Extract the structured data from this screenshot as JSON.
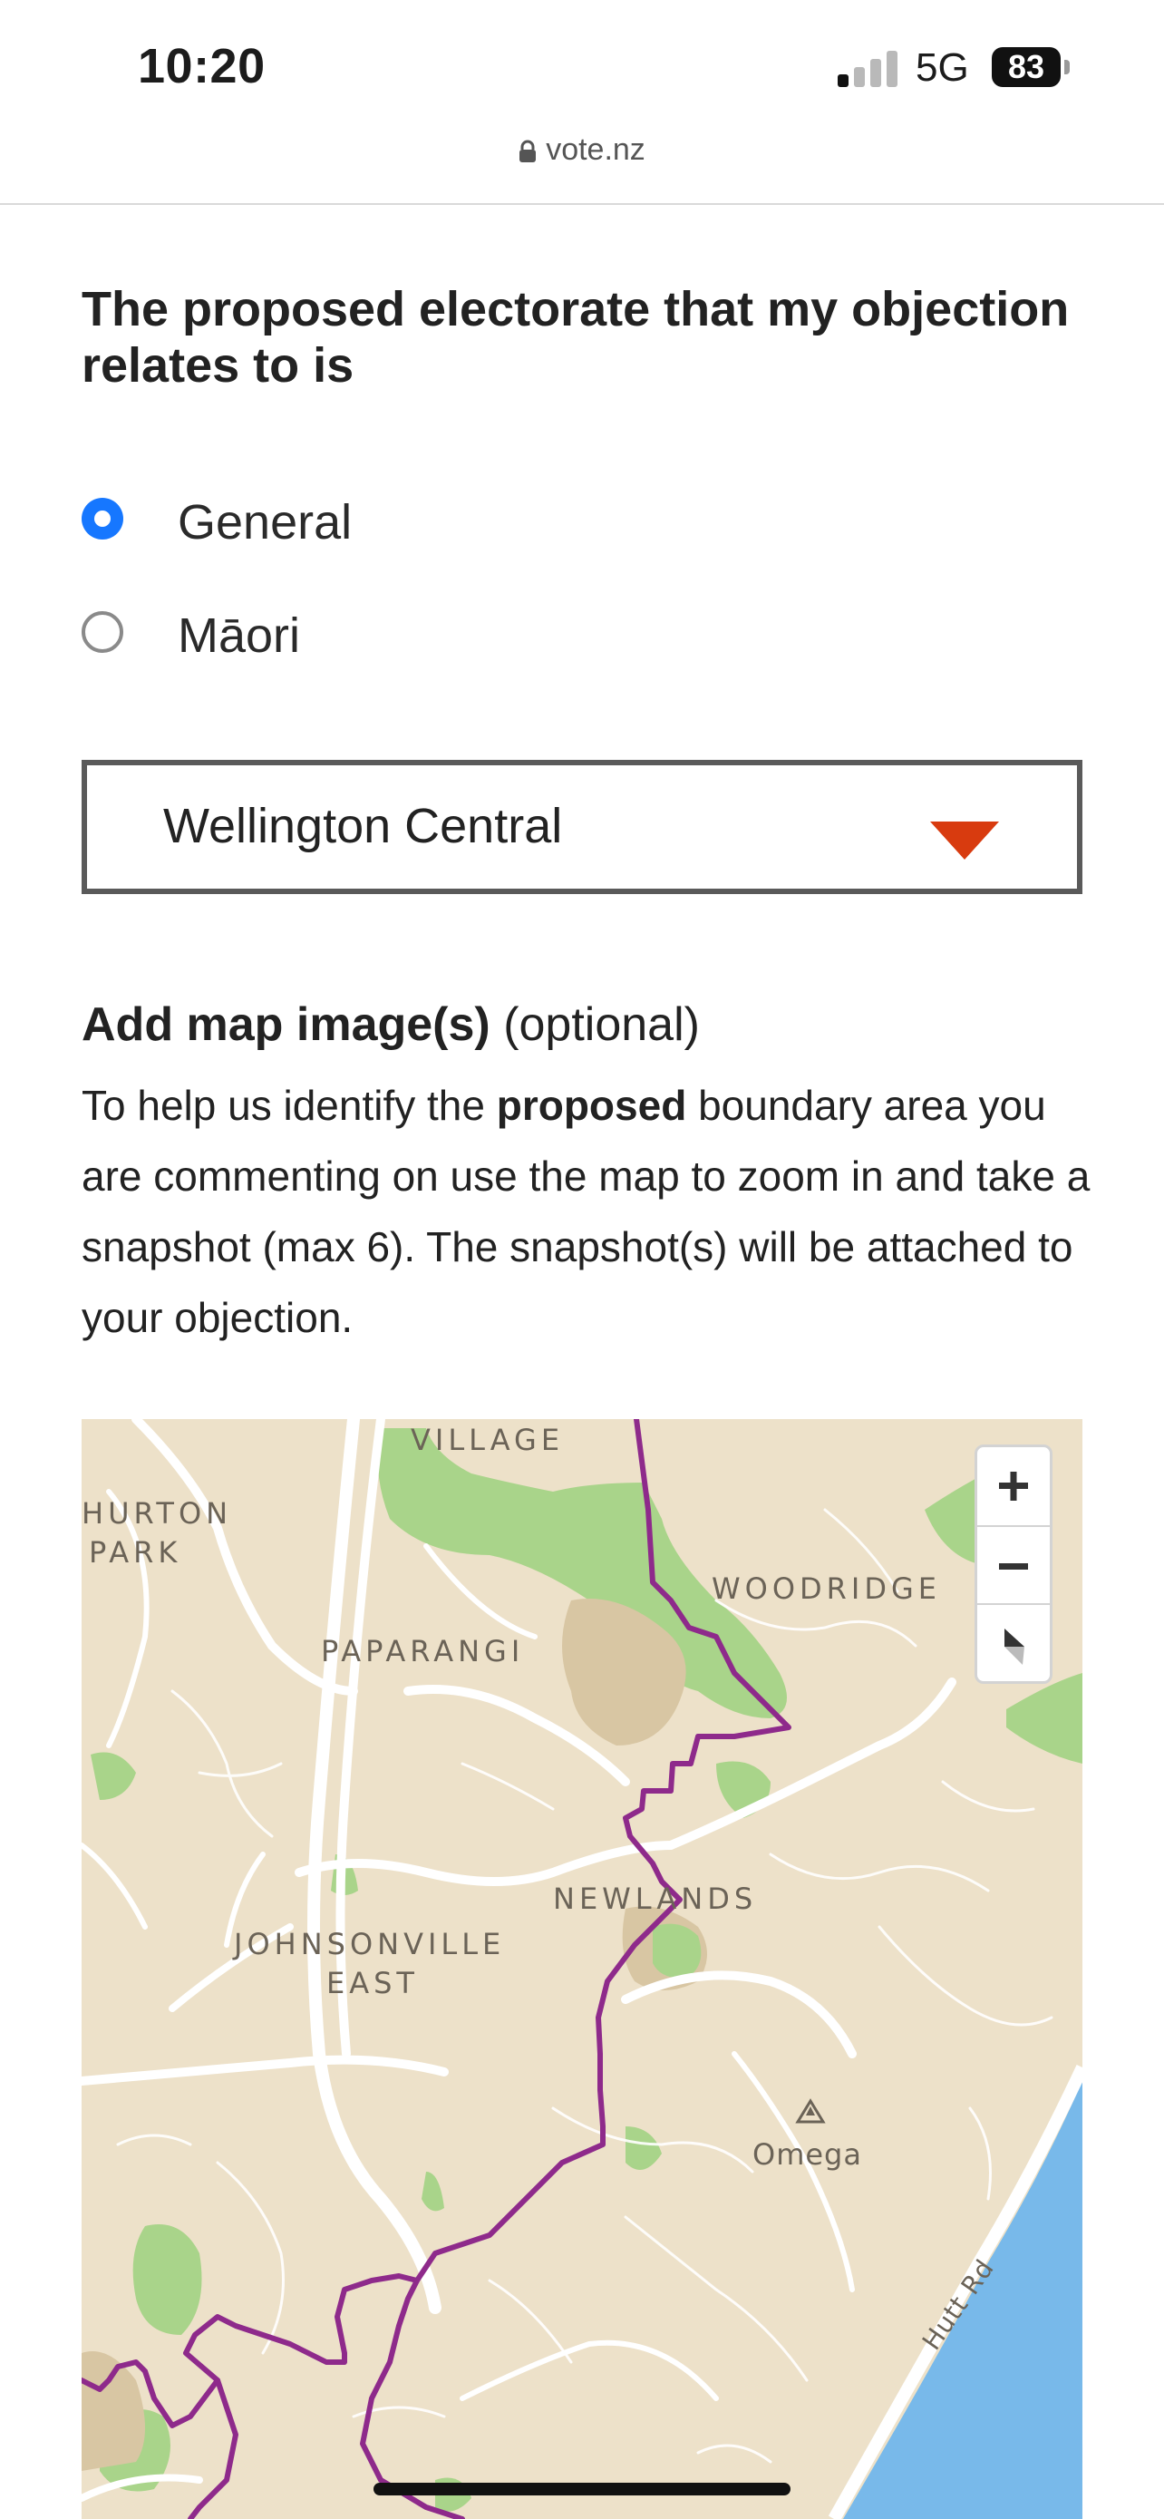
{
  "status_bar": {
    "time": "10:20",
    "network": "5G",
    "battery": "83"
  },
  "browser": {
    "url": "vote.nz"
  },
  "form": {
    "question": "The proposed electorate that my objection relates to is",
    "radio_options": [
      {
        "label": "General",
        "selected": true
      },
      {
        "label": "Māori",
        "selected": false
      }
    ],
    "dropdown_value": "Wellington Central",
    "accent_color": "#d83b0f",
    "radio_color": "#1677ff"
  },
  "map_section": {
    "title_bold": "Add map image(s)",
    "title_suffix": "(optional)",
    "desc_part1": "To help us identify the",
    "desc_bold": "proposed",
    "desc_part2": "boundary area you are commenting on use the map to zoom in and take a snapshot (max 6). The snapshot(s) will be attached to your objection."
  },
  "map": {
    "labels": {
      "village": "VILLAGE",
      "hurton": "HURTON",
      "park": "PARK",
      "woodridge": "WOODRIDGE",
      "paparangi": "PAPARANGI",
      "newlands": "NEWLANDS",
      "johnsonville": "JOHNSONVILLE",
      "east": "EAST",
      "omega": "Omega",
      "hutt_rd": "Hutt Rd"
    },
    "controls": [
      "zoom-in",
      "zoom-out",
      "reset-bearing"
    ],
    "colors": {
      "land": "#ede1c9",
      "park": "#a9d48a",
      "water": "#78b9ea",
      "boundary": "#8e2a8b",
      "road": "#ffffff"
    }
  }
}
